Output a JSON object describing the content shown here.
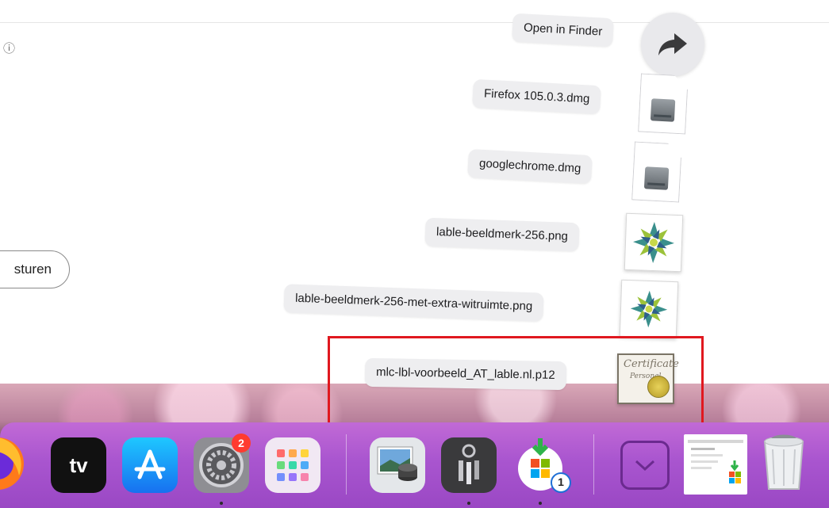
{
  "background_page": {
    "info_glyph": "ⓘ",
    "partial_button_label": "sturen"
  },
  "stack": {
    "open_in_finder_label": "Open in Finder",
    "files": [
      {
        "name": "Firefox 105.0.3.dmg",
        "icon": "disk-image-icon"
      },
      {
        "name": "googlechrome.dmg",
        "icon": "disk-image-icon"
      },
      {
        "name": "lable-beeldmerk-256.png",
        "icon": "image-thumbnail-icon"
      },
      {
        "name": "lable-beeldmerk-256-met-extra-witruimte.png",
        "icon": "image-thumbnail-icon"
      },
      {
        "name": "mlc-lbl-voorbeeld_AT_lable.nl.p12",
        "icon": "certificate-icon"
      }
    ],
    "cert_icon_text": "Certificate",
    "cert_icon_subtext": "Personal"
  },
  "highlight": {
    "color": "#e0181f",
    "target": "mlc-lbl-voorbeeld_AT_lable.nl.p12"
  },
  "dock": {
    "apps": [
      {
        "name": "firefox",
        "icon": "firefox-icon"
      },
      {
        "name": "apple-tv",
        "icon": "apple-tv-icon",
        "label": "tv"
      },
      {
        "name": "app-store",
        "icon": "app-store-icon"
      },
      {
        "name": "system-preferences",
        "icon": "gear-icon",
        "badge": "2"
      },
      {
        "name": "launchpad",
        "icon": "launchpad-icon"
      },
      {
        "name": "preview",
        "icon": "preview-icon"
      },
      {
        "name": "keychain-access",
        "icon": "keychain-icon"
      },
      {
        "name": "microsoft-installer",
        "icon": "installer-icon",
        "badge": "1"
      },
      {
        "name": "downloads-stack",
        "icon": "chevron-down-icon"
      },
      {
        "name": "recent-document",
        "icon": "document-thumbnail-icon"
      },
      {
        "name": "trash",
        "icon": "trash-icon"
      }
    ],
    "colors": {
      "dock": "#a955cf",
      "badge": "#ff3b30",
      "installer_badge": "#1f6fd6"
    }
  }
}
